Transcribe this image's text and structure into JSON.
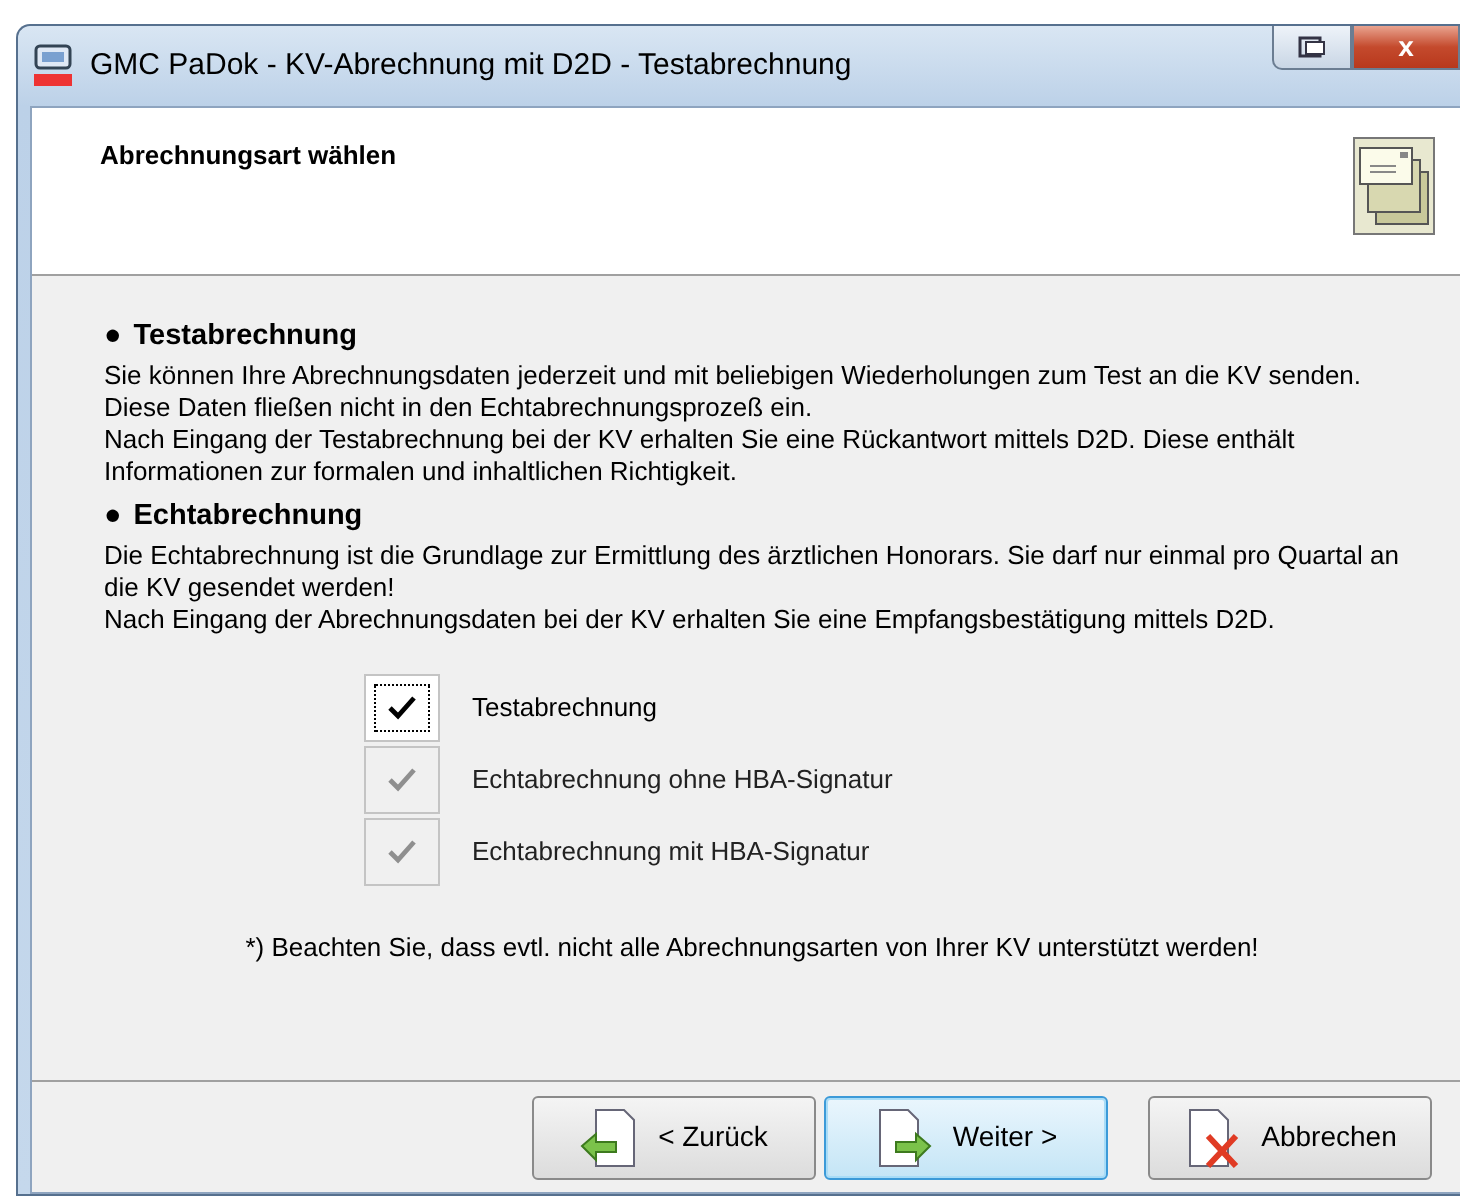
{
  "window": {
    "title": "GMC PaDok  -  KV-Abrechnung mit D2D  -  Testabrechnung",
    "close_label": "x"
  },
  "header": {
    "title": "Abrechnungsart wählen"
  },
  "sections": [
    {
      "bullet": "●",
      "heading": "Testabrechnung",
      "paragraphs": [
        "Sie können Ihre Abrechnungsdaten jederzeit und mit beliebigen Wiederholungen zum Test an die KV senden. Diese Daten fließen nicht in den Echtabrechnungsprozeß ein.",
        "Nach Eingang der Testabrechnung bei der KV erhalten Sie eine Rückantwort mittels D2D. Diese enthält Informationen zur formalen und inhaltlichen Richtigkeit."
      ]
    },
    {
      "bullet": "●",
      "heading": "Echtabrechnung",
      "paragraphs": [
        "Die Echtabrechnung ist die Grundlage zur Ermittlung des ärztlichen Honorars. Sie darf nur einmal pro Quartal an die KV gesendet werden!",
        "Nach Eingang der Abrechnungsdaten bei der KV erhalten Sie eine Empfangsbestätigung mittels D2D."
      ]
    }
  ],
  "options": [
    {
      "label": "Testabrechnung",
      "checked": true,
      "disabled": false,
      "focused": true
    },
    {
      "label": "Echtabrechnung ohne HBA-Signatur",
      "checked": true,
      "disabled": true,
      "focused": false
    },
    {
      "label": "Echtabrechnung mit HBA-Signatur",
      "checked": true,
      "disabled": true,
      "focused": false
    }
  ],
  "note": "*) Beachten Sie, dass evtl. nicht alle Abrechnungsarten von Ihrer KV unterstützt werden!",
  "buttons": [
    {
      "kind": "back",
      "label": "< Zurück",
      "default": false
    },
    {
      "kind": "next",
      "label": "Weiter >",
      "default": true
    },
    {
      "kind": "cancel",
      "label": "Abbrechen",
      "default": false
    }
  ]
}
